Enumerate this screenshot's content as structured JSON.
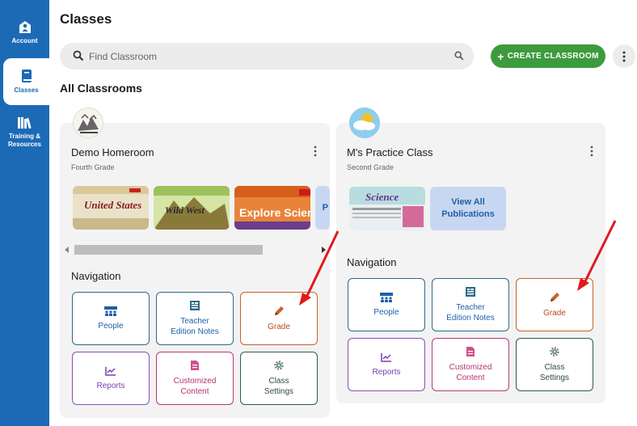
{
  "sidebar": {
    "items": [
      {
        "label": "Account",
        "icon": "account-icon"
      },
      {
        "label": "Classes",
        "icon": "book-icon",
        "active": true
      },
      {
        "label_line1": "Training &",
        "label_line2": "Resources",
        "icon": "library-icon"
      }
    ],
    "accent_color": "#1c6ab5"
  },
  "header": {
    "title": "Classes",
    "search_placeholder": "Find Classroom",
    "create_label": "CREATE CLASSROOM"
  },
  "section_title": "All Classrooms",
  "classes": [
    {
      "name": "Demo Homeroom",
      "grade": "Fourth Grade",
      "publications": [
        "United States",
        "Wild West",
        "Explore Science"
      ],
      "partial_tile_letter": "P",
      "navigation_heading": "Navigation",
      "tiles": {
        "people": "People",
        "teacher_notes_1": "Teacher",
        "teacher_notes_2": "Edition Notes",
        "grade": "Grade",
        "reports": "Reports",
        "customized_1": "Customized",
        "customized_2": "Content",
        "settings_1": "Class",
        "settings_2": "Settings"
      }
    },
    {
      "name": "M's Practice Class",
      "grade": "Second Grade",
      "publications": [
        "Science"
      ],
      "view_all_1": "View All",
      "view_all_2": "Publications",
      "navigation_heading": "Navigation",
      "tiles": {
        "people": "People",
        "teacher_notes_1": "Teacher",
        "teacher_notes_2": "Edition Notes",
        "grade": "Grade",
        "reports": "Reports",
        "customized_1": "Customized",
        "customized_2": "Content",
        "settings_1": "Class",
        "settings_2": "Settings"
      }
    }
  ],
  "colors": {
    "create_button": "#3d9b3d",
    "annotation_arrow": "#e0191c"
  }
}
